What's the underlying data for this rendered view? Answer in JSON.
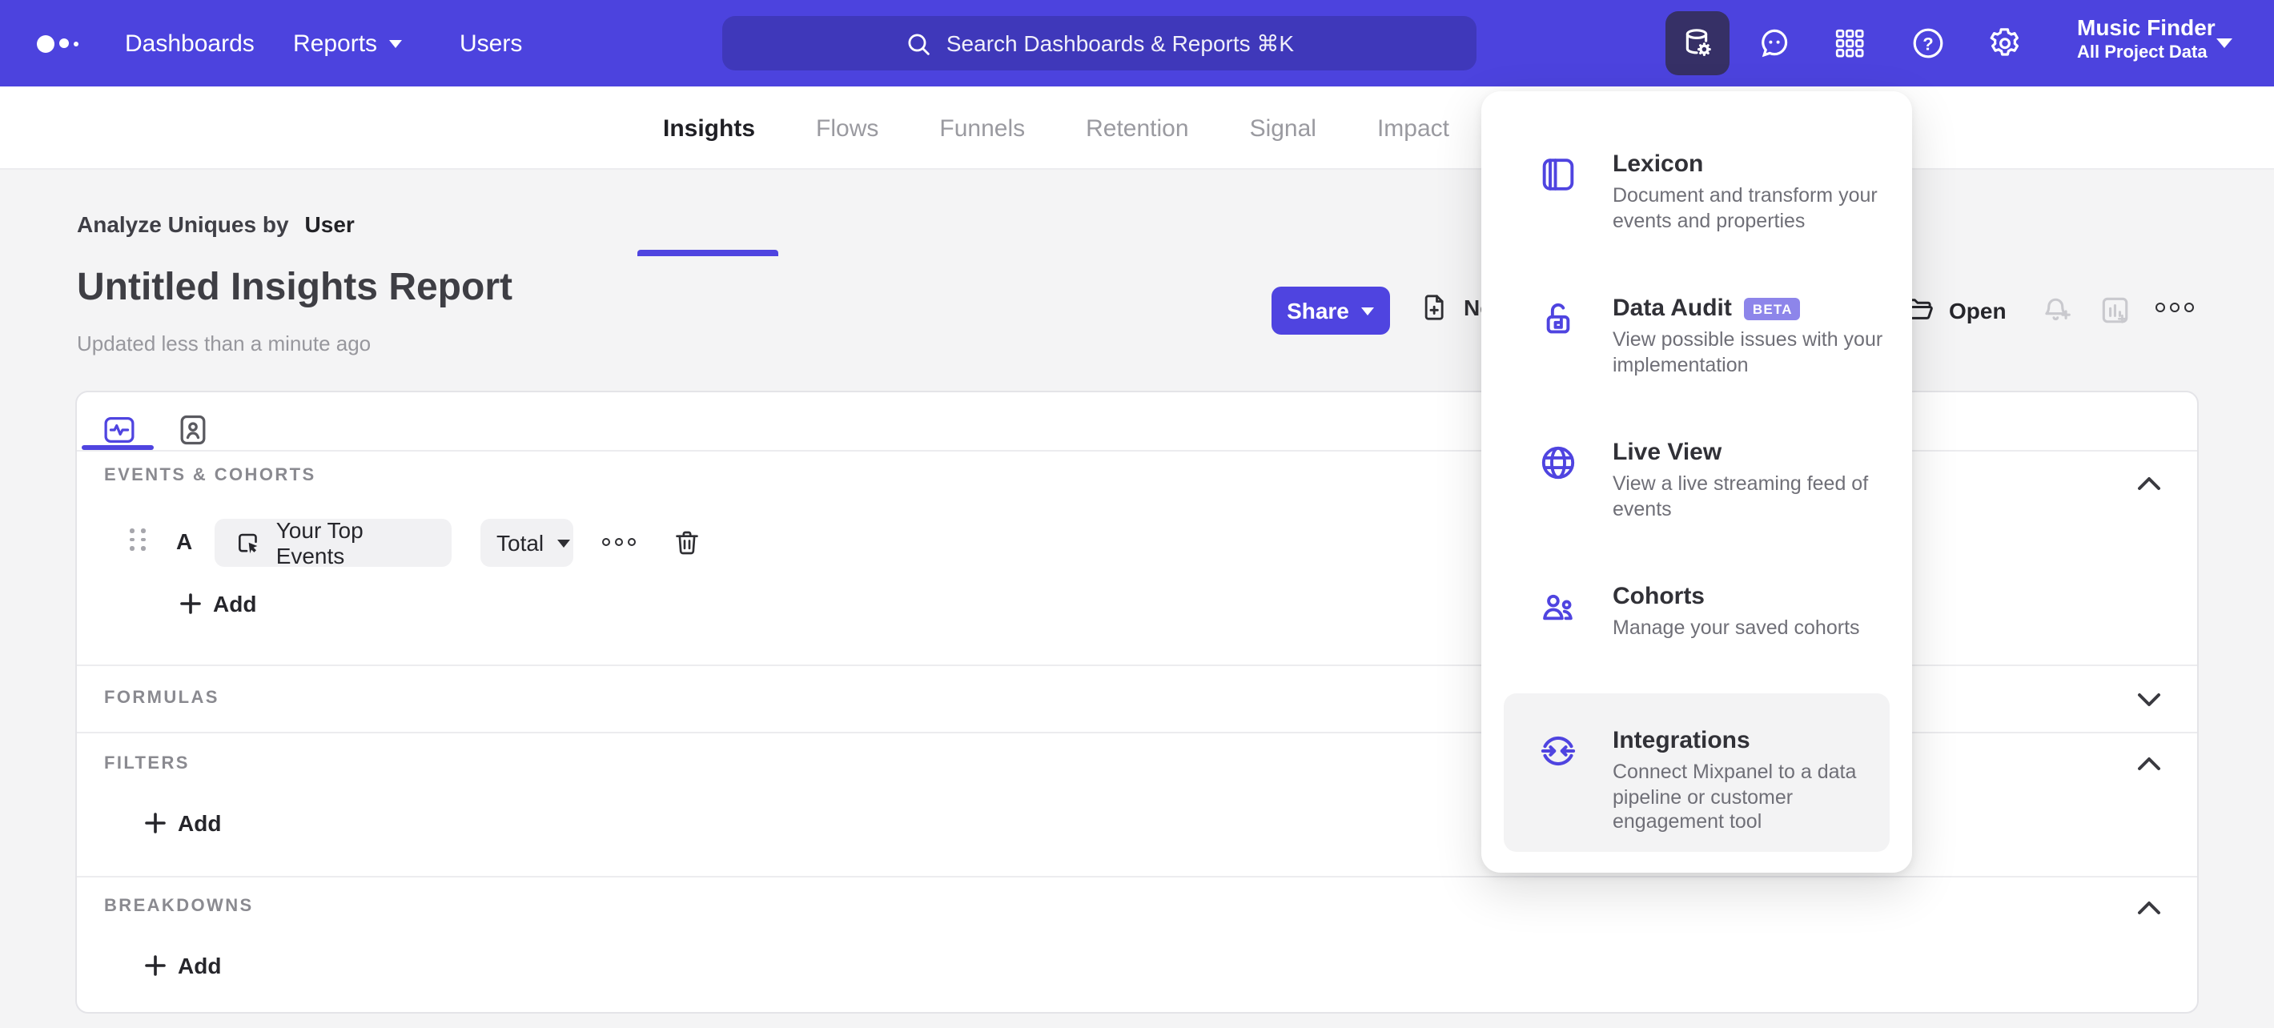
{
  "navbar": {
    "links": [
      {
        "label": "Dashboards"
      },
      {
        "label": "Reports",
        "has_caret": true
      },
      {
        "label": "Users"
      }
    ],
    "search": {
      "placeholder": "Search Dashboards & Reports ⌘K"
    },
    "icons": [
      "data-management",
      "feedback",
      "apps-grid",
      "help",
      "settings"
    ],
    "active_icon": "data-management",
    "project": {
      "name": "Music Finder",
      "scope": "All Project Data"
    }
  },
  "tabs": {
    "items": [
      {
        "label": "Insights",
        "active": true
      },
      {
        "label": "Flows"
      },
      {
        "label": "Funnels"
      },
      {
        "label": "Retention"
      },
      {
        "label": "Signal"
      },
      {
        "label": "Impact"
      }
    ]
  },
  "report": {
    "analysis_prefix": "Analyze Uniques by",
    "analysis_value": "User",
    "title": "Untitled Insights Report",
    "updated": "Updated less than a minute ago",
    "share_label": "Share",
    "new_label": "New",
    "open_label": "Open"
  },
  "builder": {
    "events": {
      "label": "EVENTS & COHORTS",
      "row": {
        "letter": "A",
        "event": "Your Top Events",
        "metric": "Total"
      },
      "add_label": "Add",
      "expanded": true
    },
    "formulas": {
      "label": "FORMULAS",
      "expanded": false
    },
    "filters": {
      "label": "FILTERS",
      "add_label": "Add",
      "expanded": true
    },
    "breakdowns": {
      "label": "BREAKDOWNS",
      "add_label": "Add",
      "expanded": true
    }
  },
  "menu": {
    "items": [
      {
        "title": "Lexicon",
        "desc": "Document and transform your events and properties"
      },
      {
        "title": "Data Audit",
        "badge": "BETA",
        "desc": "View possible issues with your implementation"
      },
      {
        "title": "Live View",
        "desc": "View a live streaming feed of events"
      },
      {
        "title": "Cohorts",
        "desc": "Manage your saved cohorts"
      },
      {
        "title": "Integrations",
        "desc": "Connect Mixpanel to a data pipeline or customer engagement tool",
        "highlighted": true
      }
    ]
  },
  "colors": {
    "navbar": "#4C43DE",
    "accent": "#4F44E0",
    "badge": "#8D85EA",
    "text_dark": "#2F2F33",
    "text_gray": "#9A9AA0",
    "page_bg": "#F4F4F5"
  }
}
